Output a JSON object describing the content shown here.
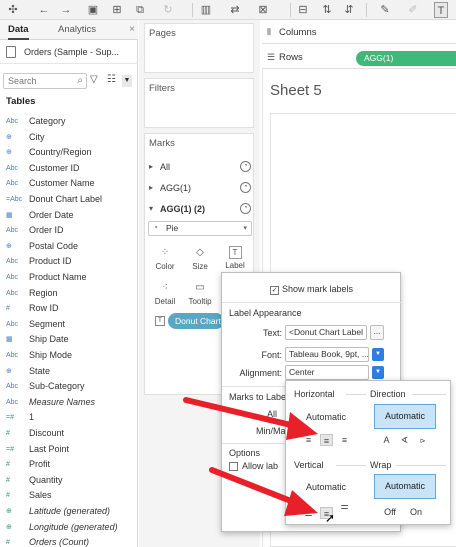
{
  "toolbar": {
    "icons": [
      "tableau-logo-icon",
      "back-icon",
      "forward-icon",
      "save-icon",
      "new-datasource-icon",
      "duplicate-icon",
      "refresh-icon",
      "chart-icon",
      "swap-icon",
      "clear-icon",
      "group-icon",
      "sort-asc-icon",
      "sort-desc-icon",
      "highlight-icon",
      "pen-icon",
      "label-icon"
    ]
  },
  "left_pane": {
    "tabs": [
      {
        "label": "Data",
        "active": true
      },
      {
        "label": "Analytics",
        "active": false
      }
    ],
    "close_glyph": "×",
    "datasource": "Orders (Sample - Sup...",
    "search_placeholder": "Search",
    "tables_header": "Tables",
    "fields": [
      {
        "type": "Abc",
        "name": "Category",
        "kind": "dim"
      },
      {
        "type": "⊕",
        "name": "City",
        "kind": "dim"
      },
      {
        "type": "⊕",
        "name": "Country/Region",
        "kind": "dim"
      },
      {
        "type": "Abc",
        "name": "Customer ID",
        "kind": "dim"
      },
      {
        "type": "Abc",
        "name": "Customer Name",
        "kind": "dim"
      },
      {
        "type": "=Abc",
        "name": "Donut Chart Label",
        "kind": "dim"
      },
      {
        "type": "▦",
        "name": "Order Date",
        "kind": "dim"
      },
      {
        "type": "Abc",
        "name": "Order ID",
        "kind": "dim"
      },
      {
        "type": "⊕",
        "name": "Postal Code",
        "kind": "dim"
      },
      {
        "type": "Abc",
        "name": "Product ID",
        "kind": "dim"
      },
      {
        "type": "Abc",
        "name": "Product Name",
        "kind": "dim"
      },
      {
        "type": "Abc",
        "name": "Region",
        "kind": "dim"
      },
      {
        "type": "#",
        "name": "Row ID",
        "kind": "dim"
      },
      {
        "type": "Abc",
        "name": "Segment",
        "kind": "dim"
      },
      {
        "type": "▦",
        "name": "Ship Date",
        "kind": "dim"
      },
      {
        "type": "Abc",
        "name": "Ship Mode",
        "kind": "dim"
      },
      {
        "type": "⊕",
        "name": "State",
        "kind": "dim"
      },
      {
        "type": "Abc",
        "name": "Sub-Category",
        "kind": "dim"
      },
      {
        "type": "Abc",
        "name": "Measure Names",
        "kind": "dim",
        "italic": true
      },
      {
        "type": "=#",
        "name": "1",
        "kind": "meas"
      },
      {
        "type": "#",
        "name": "Discount",
        "kind": "meas"
      },
      {
        "type": "=#",
        "name": "Last Point",
        "kind": "meas"
      },
      {
        "type": "#",
        "name": "Profit",
        "kind": "meas"
      },
      {
        "type": "#",
        "name": "Quantity",
        "kind": "meas"
      },
      {
        "type": "#",
        "name": "Sales",
        "kind": "meas"
      },
      {
        "type": "⊕",
        "name": "Latitude (generated)",
        "kind": "meas",
        "italic": true
      },
      {
        "type": "⊕",
        "name": "Longitude (generated)",
        "kind": "meas",
        "italic": true
      },
      {
        "type": "#",
        "name": "Orders (Count)",
        "kind": "meas",
        "italic": true
      }
    ]
  },
  "cards": {
    "pages": "Pages",
    "filters": "Filters",
    "marks": "Marks",
    "marks_rows": [
      {
        "arrow": "▸",
        "label": "All"
      },
      {
        "arrow": "▸",
        "label": "AGG(1)"
      },
      {
        "arrow": "▾",
        "label": "AGG(1) (2)",
        "bold": true
      }
    ],
    "mark_type": "Pie",
    "mark_buttons": [
      {
        "icon": "color-icon",
        "glyph": "⁘",
        "label": "Color"
      },
      {
        "icon": "size-icon",
        "glyph": "◇",
        "label": "Size"
      },
      {
        "icon": "label-icon",
        "glyph": "T",
        "label": "Label"
      },
      {
        "icon": "detail-icon",
        "glyph": "⁖",
        "label": "Detail"
      },
      {
        "icon": "tooltip-icon",
        "glyph": "▭",
        "label": "Tooltip"
      }
    ],
    "label_pill": "Donut Chart Label"
  },
  "shelves": {
    "columns": "Columns",
    "rows": "Rows",
    "rows_pill": "AGG(1)"
  },
  "sheet": {
    "title": "Sheet 5"
  },
  "label_popover": {
    "show_mark_labels": "Show mark labels",
    "appearance_header": "Label Appearance",
    "text_key": "Text:",
    "text_value": "<Donut Chart Label",
    "text_btn": "...",
    "font_key": "Font:",
    "font_value": "Tableau Book, 9pt, ...",
    "align_key": "Alignment:",
    "align_value": "Center",
    "marks_to_label": "Marks to Label",
    "all": "All",
    "minmax": "Min/Ma",
    "options": "Options",
    "allow_label": "Allow lab"
  },
  "alignment_popover": {
    "horizontal": "Horizontal",
    "direction": "Direction",
    "vertical": "Vertical",
    "wrap": "Wrap",
    "h_automatic": "Automatic",
    "dir_automatic": "Automatic",
    "v_automatic": "Automatic",
    "wrap_automatic": "Automatic",
    "off": "Off",
    "on": "On"
  },
  "colors": {
    "rows_pill": "#40b87a",
    "label_pill": "#5aa7c4",
    "annotation_arrow": "#e8202a",
    "selected_option": "#c9e3f7"
  }
}
